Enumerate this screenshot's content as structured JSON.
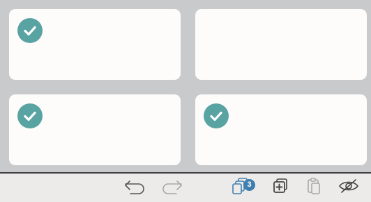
{
  "colors": {
    "background": "#c9cacc",
    "card": "#fdfcfb",
    "check": "#5aa3a3",
    "toolbar": "#ecebea",
    "icon": "#555555",
    "icon_disabled": "#a8a8a8",
    "accent": "#3f7fb0"
  },
  "cards": [
    {
      "selected": true,
      "check_icon": "checkmark-circle-icon"
    },
    {
      "selected": false
    },
    {
      "selected": true,
      "check_icon": "checkmark-circle-icon"
    },
    {
      "selected": true,
      "check_icon": "checkmark-circle-icon"
    }
  ],
  "toolbar": {
    "undo_icon": "undo-arrow-icon",
    "redo_icon": "redo-arrow-icon",
    "redo_enabled": false,
    "pages_icon": "stacked-pages-icon",
    "pages_count": "3",
    "add_icon": "add-page-icon",
    "paste_icon": "clipboard-icon",
    "paste_enabled": false,
    "hide_icon": "eye-slash-icon"
  }
}
